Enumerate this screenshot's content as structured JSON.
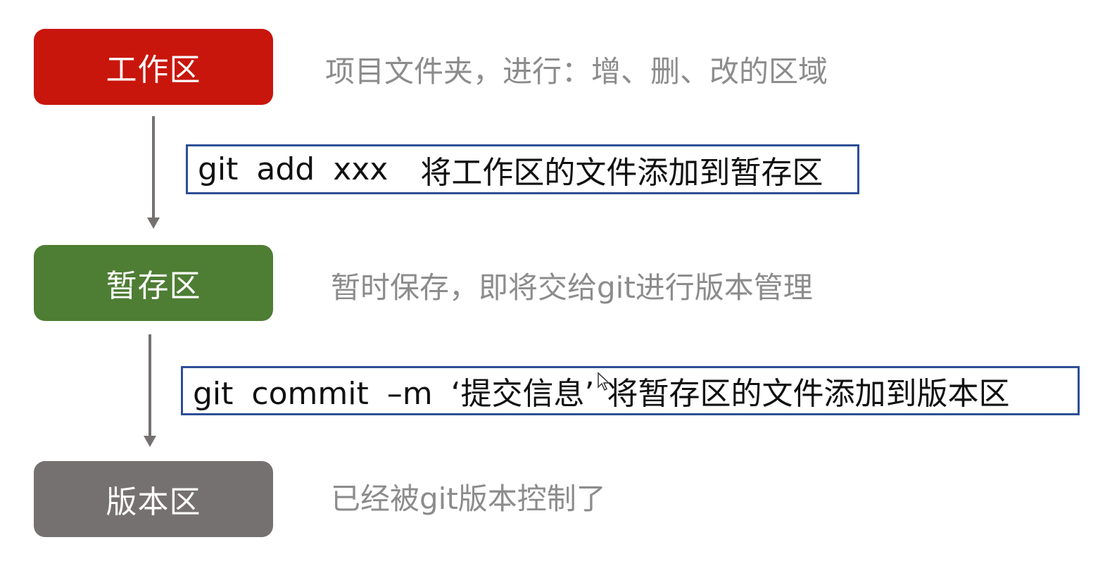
{
  "stages": {
    "work": {
      "label": "工作区",
      "color": "#c8160c"
    },
    "staging": {
      "label": "暂存区",
      "color": "#4e7d34"
    },
    "repository": {
      "label": "版本区",
      "color": "#767171"
    }
  },
  "descriptions": {
    "work": "项目文件夹，进行：增、删、改的区域",
    "staging": "暂时保存，即将交给git进行版本管理",
    "repository": "已经被git版本控制了"
  },
  "commands": {
    "add": {
      "code": "git  add  xxx",
      "explain": "将工作区的文件添加到暂存区"
    },
    "commit": {
      "code": "git  commit  –m  ‘提交信息’",
      "explain": "将暂存区的文件添加到版本区"
    }
  },
  "box_border_color": "#2e4f96"
}
